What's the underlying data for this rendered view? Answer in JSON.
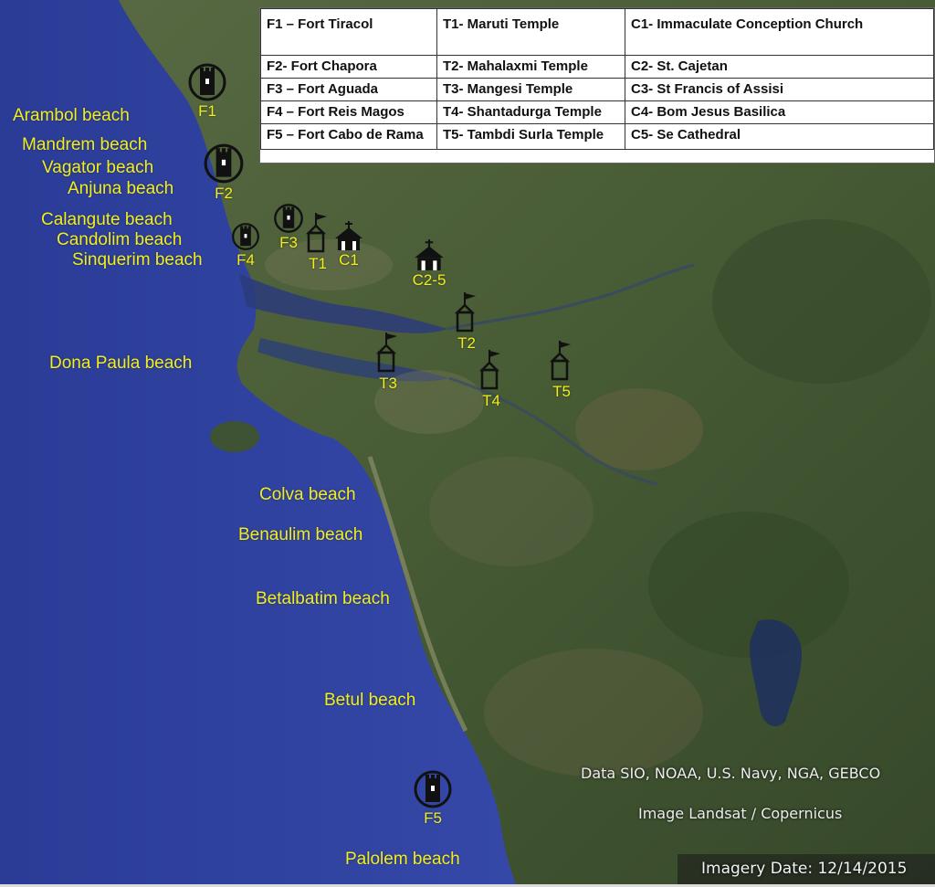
{
  "legend": {
    "rows": [
      [
        "F1 – Fort Tiracol",
        "T1- Maruti Temple",
        "C1- Immaculate Conception Church"
      ],
      [
        "F2- Fort Chapora",
        "T2- Mahalaxmi Temple",
        "C2- St. Cajetan"
      ],
      [
        "F3 – Fort Aguada",
        "T3- Mangesi Temple",
        "C3- St Francis of Assisi"
      ],
      [
        "F4 – Fort Reis Magos",
        "T4- Shantadurga Temple",
        "C4- Bom Jesus Basilica"
      ],
      [
        "F5 – Fort Cabo de Rama",
        "T5- Tambdi Surla Temple",
        "C5- Se Cathedral"
      ]
    ]
  },
  "beaches": [
    "Arambol beach",
    "Mandrem beach",
    "Vagator beach",
    "Anjuna beach",
    "Calangute beach",
    "Candolim beach",
    "Sinquerim beach",
    "Dona Paula beach",
    "Colva beach",
    "Benaulim beach",
    "Betalbatim beach",
    "Betul beach",
    "Palolem beach"
  ],
  "markers": {
    "forts": [
      "F1",
      "F2",
      "F3",
      "F4",
      "F5"
    ],
    "temples": [
      "T1",
      "T2",
      "T3",
      "T4",
      "T5"
    ],
    "churches": [
      "C1",
      "C2-5"
    ]
  },
  "credits": {
    "data": "Data SIO, NOAA, U.S. Navy, NGA, GEBCO",
    "image": "Image Landsat / Copernicus",
    "date": "Imagery Date: 12/14/2015"
  },
  "colors": {
    "ocean": "#2a3f9b",
    "land": "#4a5e3a",
    "label_yellow": "#f2ee1e"
  },
  "icons": {
    "fort": "fort-tower-icon",
    "temple": "temple-flag-icon",
    "church": "church-icon"
  }
}
